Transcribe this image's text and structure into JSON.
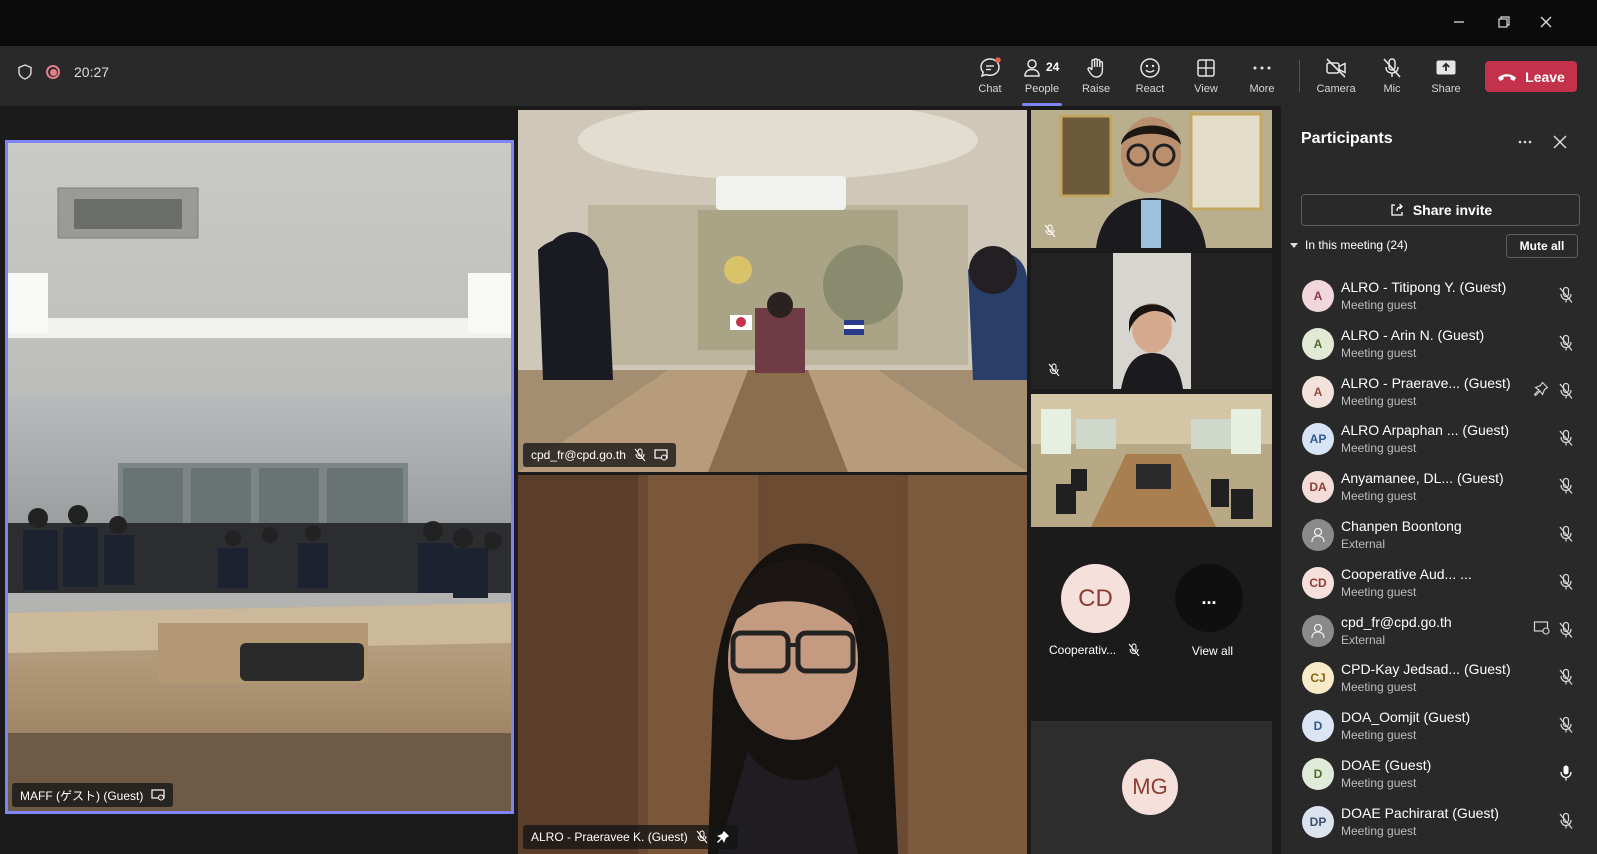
{
  "status": {
    "timer": "20:27"
  },
  "toolbar": {
    "chat": "Chat",
    "people": "People",
    "people_count": "24",
    "raise": "Raise",
    "react": "React",
    "view": "View",
    "more": "More",
    "camera": "Camera",
    "mic": "Mic",
    "share": "Share",
    "leave": "Leave"
  },
  "tiles": {
    "maff": "MAFF (ゲスト) (Guest)",
    "cpd": "cpd_fr@cpd.go.th",
    "alro": "ALRO - Praeravee K. (Guest)",
    "cd_initials": "CD",
    "cd_name": "Cooperativ...",
    "view_all_dots": "...",
    "view_all": "View all",
    "mg_initials": "MG"
  },
  "panel": {
    "title": "Participants",
    "share_invite": "Share invite",
    "in_meeting": "In this meeting (24)",
    "mute_all": "Mute all",
    "participants": [
      {
        "initials": "A",
        "name": "ALRO - Titipong Y. (Guest)",
        "sub": "Meeting guest",
        "bg": "#f1d7db",
        "fg": "#8a3b46",
        "mic": "off"
      },
      {
        "initials": "A",
        "name": "ALRO - Arin N. (Guest)",
        "sub": "Meeting guest",
        "bg": "#e2ead6",
        "fg": "#4e6b2c",
        "mic": "off"
      },
      {
        "initials": "A",
        "name": "ALRO - Praerave...  (Guest)",
        "sub": "Meeting guest",
        "bg": "#f3e1dc",
        "fg": "#8f4d3d",
        "mic": "off",
        "pin": true
      },
      {
        "initials": "AP",
        "name": "ALRO Arpaphan ... (Guest)",
        "sub": "Meeting guest",
        "bg": "#d7e4f5",
        "fg": "#2f5a8f",
        "mic": "off"
      },
      {
        "initials": "DA",
        "name": "Anyamanee, DL...  (Guest)",
        "sub": "Meeting guest",
        "bg": "#f4ddd8",
        "fg": "#8d3e33",
        "mic": "off"
      },
      {
        "initials": "",
        "name": "Chanpen Boontong",
        "sub": "External",
        "bg": "#8a8a8a",
        "fg": "#eeeeee",
        "mic": "off",
        "generic": true
      },
      {
        "initials": "CD",
        "name": "Cooperative Aud... ...",
        "sub": "Meeting guest",
        "bg": "#f6e0dc",
        "fg": "#8d3e33",
        "mic": "off"
      },
      {
        "initials": "",
        "name": "cpd_fr@cpd.go.th",
        "sub": "External",
        "bg": "#8a8a8a",
        "fg": "#eeeeee",
        "mic": "off",
        "generic": true,
        "share": true
      },
      {
        "initials": "CJ",
        "name": "CPD-Kay Jedsad...  (Guest)",
        "sub": "Meeting guest",
        "bg": "#f7ebc9",
        "fg": "#8a6411",
        "mic": "off"
      },
      {
        "initials": "D",
        "name": "DOA_Oomjit (Guest)",
        "sub": "Meeting guest",
        "bg": "#dbe5f4",
        "fg": "#2f5a8f",
        "mic": "off"
      },
      {
        "initials": "D",
        "name": "DOAE (Guest)",
        "sub": "Meeting guest",
        "bg": "#e0ead9",
        "fg": "#4e6b2c",
        "mic": "on"
      },
      {
        "initials": "DP",
        "name": "DOAE Pachirarat (Guest)",
        "sub": "Meeting guest",
        "bg": "#dde3ee",
        "fg": "#3c4f73",
        "mic": "off"
      }
    ]
  }
}
